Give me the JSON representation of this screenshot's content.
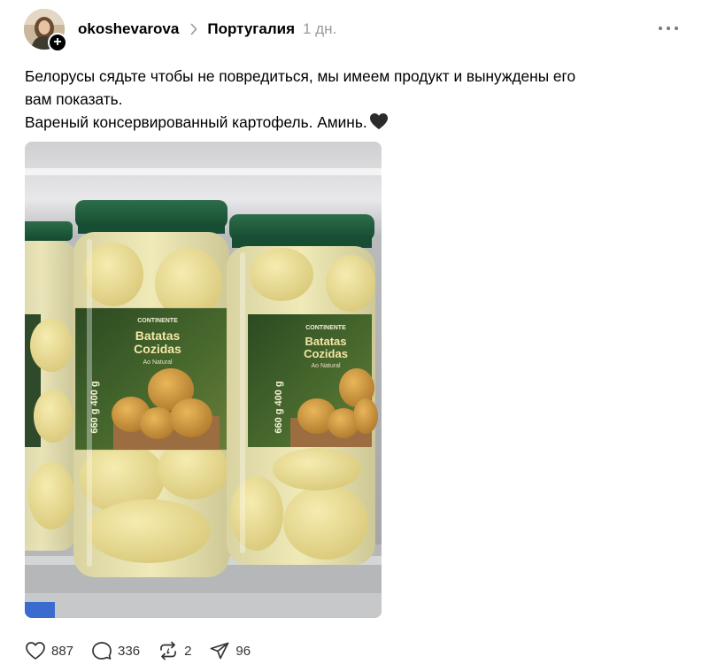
{
  "header": {
    "username": "okoshevarova",
    "topic": "Португалия",
    "time": "1 дн.",
    "follow_symbol": "+"
  },
  "post": {
    "lines": [
      "Белорусы сядьте чтобы не повредиться, мы имеем продукт и вынуждены его",
      "вам показать.",
      "Вареный консервированный картофель. Аминь."
    ],
    "emoji": "black-heart"
  },
  "media": {
    "label_brand": "CONTINENTE",
    "label_title_1": "Batatas",
    "label_title_2": "Cozidas",
    "label_subtitle": "Ao Natural",
    "label_weight": "660 g  400 g"
  },
  "actions": {
    "likes": "887",
    "comments": "336",
    "reposts": "2",
    "shares": "96"
  },
  "colors": {
    "text": "#000000",
    "muted": "#999999",
    "lid": "#1f5a3c",
    "label_dark": "#1a3a22",
    "potato": "#e9dc94"
  }
}
